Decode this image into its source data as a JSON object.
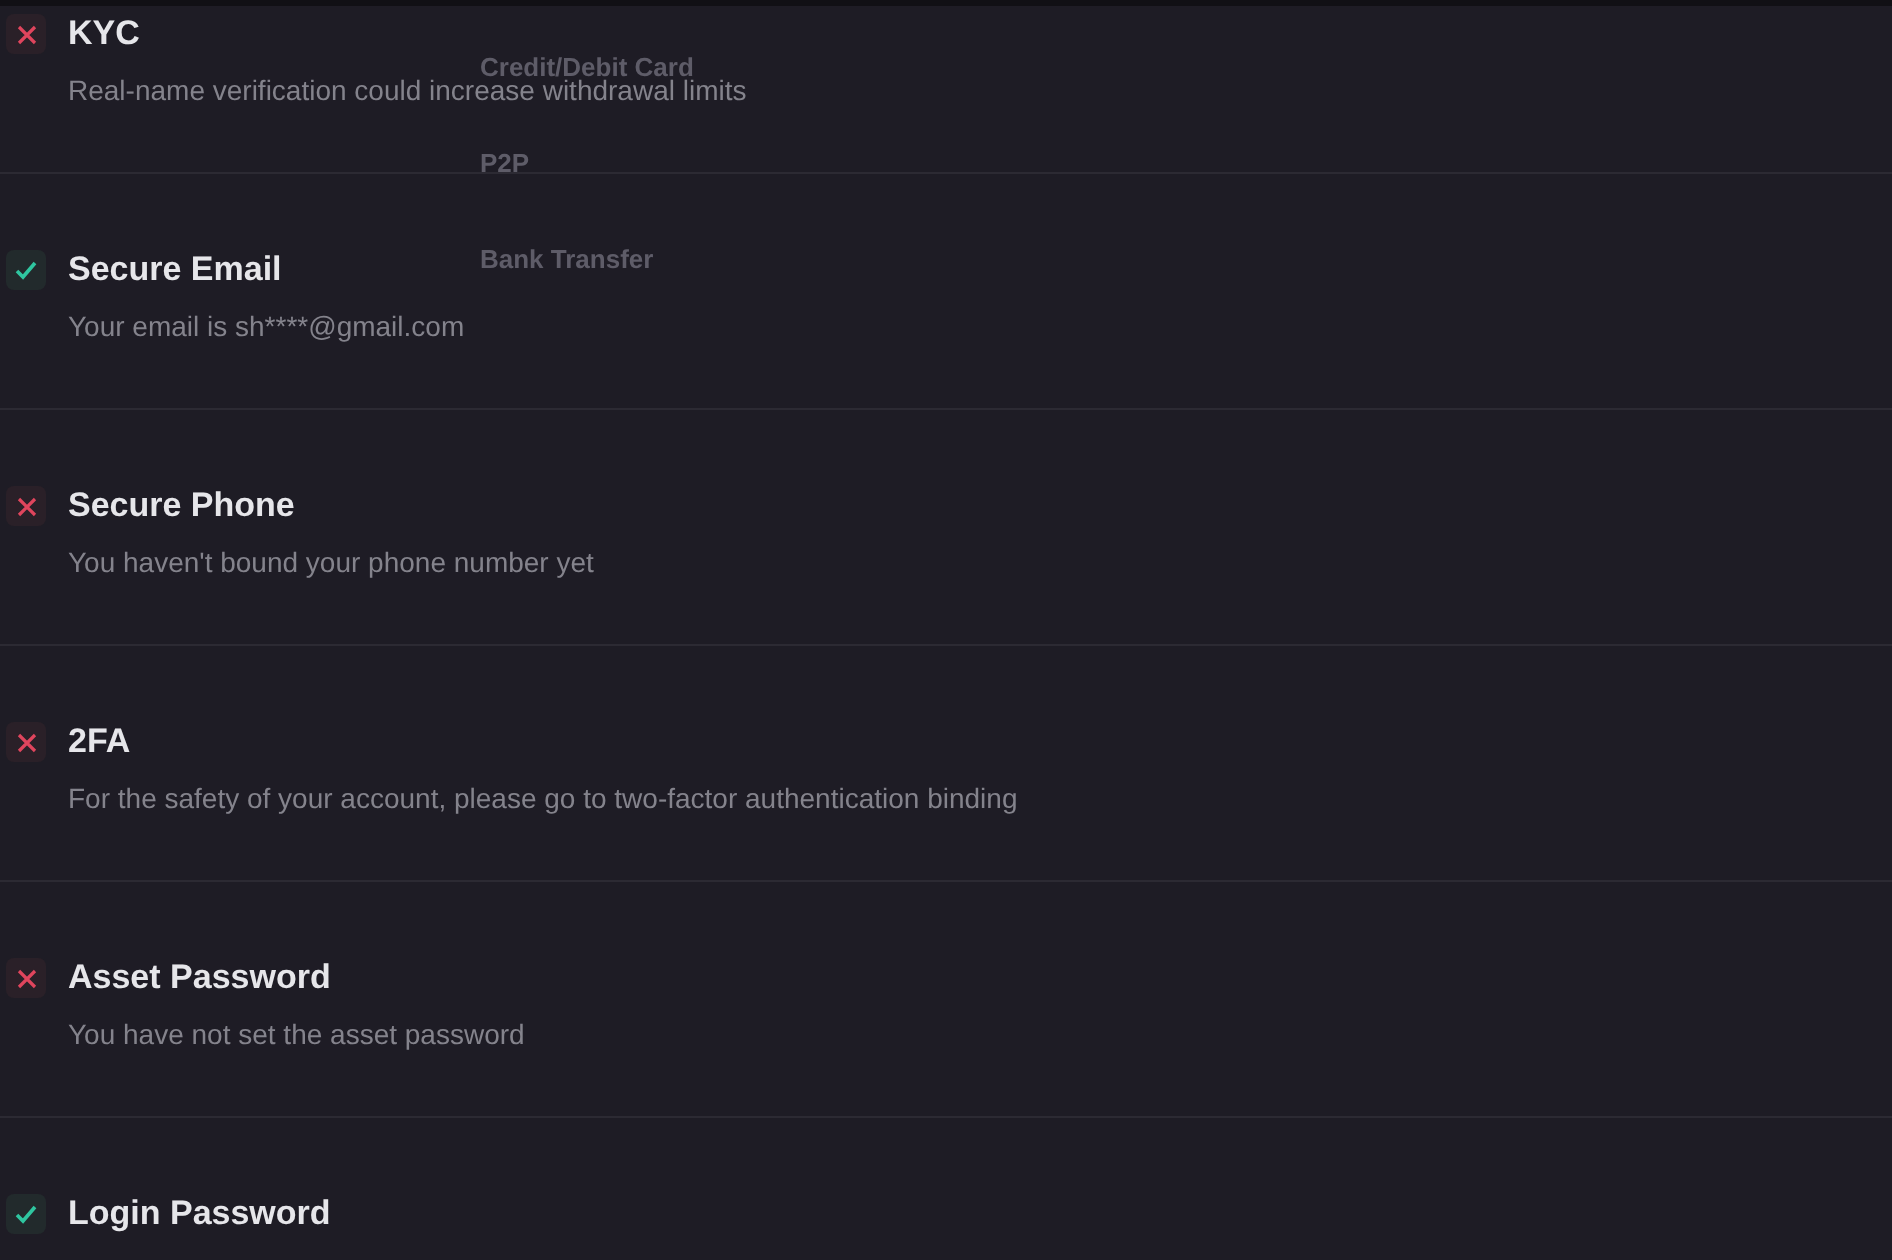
{
  "items": [
    {
      "title": "KYC",
      "description": "Real-name verification could increase withdrawal limits",
      "verified": false
    },
    {
      "title": "Secure Email",
      "description": "Your email is sh****@gmail.com",
      "verified": true
    },
    {
      "title": "Secure Phone",
      "description": "You haven't bound your phone number yet",
      "verified": false
    },
    {
      "title": "2FA",
      "description": "For the safety of your account, please go to two-factor authentication binding",
      "verified": false
    },
    {
      "title": "Asset Password",
      "description": "You have not set the asset password",
      "verified": false
    },
    {
      "title": "Login Password",
      "verified": true
    }
  ],
  "faded_menu": [
    "Credit/Debit Card",
    "P2P",
    "Bank Transfer"
  ]
}
